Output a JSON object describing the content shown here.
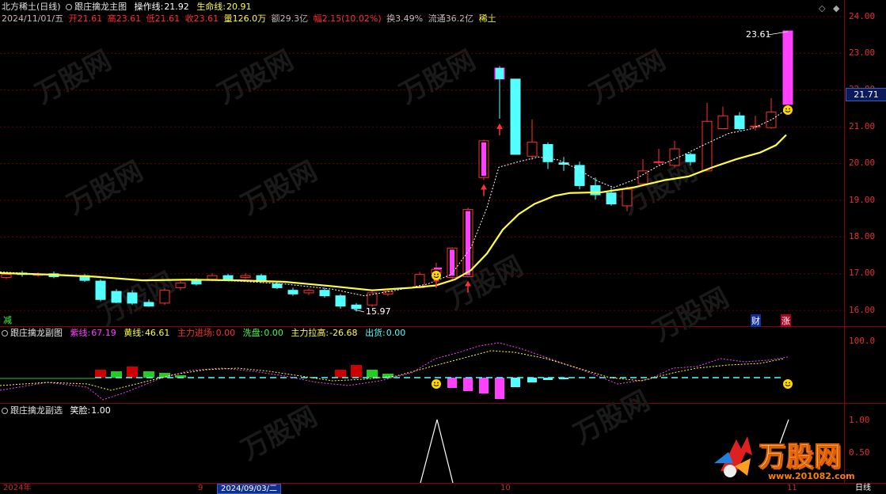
{
  "main_header": {
    "name": "北方稀土(日线)",
    "indicator": "跟庄擒龙主图",
    "caozuo_label": "操作线:",
    "caozuo_value": "21.92",
    "shengming_label": "生命线:",
    "shengming_value": "20.91",
    "date": "2024/11/01/五",
    "open_label": "开",
    "open": "21.61",
    "high_label": "高",
    "high": "23.61",
    "low_label": "低",
    "low": "21.61",
    "close_label": "收",
    "close": "23.61",
    "vol_label": "量",
    "vol": "126.0万",
    "amount_label": "额",
    "amount": "29.3亿",
    "range_label": "幅",
    "range": "2.15(10.02%)",
    "turnover_label": "换",
    "turnover": "3.49%",
    "float_label": "流通",
    "float": "36.2亿",
    "concept": "稀土"
  },
  "sub1_header": {
    "name": "跟庄擒龙副图",
    "purple_label": "紫线:",
    "purple": "67.19",
    "yellow_label": "黄线:",
    "yellow": "46.61",
    "zhuli_in_label": "主力进场:",
    "zhuli_in": "0.00",
    "xipan_label": "洗盘:",
    "xipan": "0.00",
    "lagao_label": "主力拉高:",
    "lagao": "-26.68",
    "chuhuo_label": "出货:",
    "chuhuo": "0.00"
  },
  "sub2_header": {
    "name": "跟庄擒龙副选",
    "smile_label": "笑脸:",
    "smile": "1.00"
  },
  "price_axis": [
    "24.00",
    "23.00",
    "22.00",
    "21.00",
    "20.00",
    "19.00",
    "18.00",
    "17.00",
    "16.00"
  ],
  "current_price_tag": "21.71",
  "sub1_axis": [
    "100.0"
  ],
  "sub2_axis": [
    "1.00",
    "0.50"
  ],
  "annotations": {
    "high_label": "23.61",
    "low_label": "15.97",
    "jian": "减",
    "cai": "财",
    "zhang": "涨"
  },
  "bottom_axis": {
    "year": "2024年",
    "tick_9": "9",
    "cursor_date": "2024/09/03/二",
    "tick_10": "10",
    "tick_11": "11",
    "period": "日线"
  },
  "watermark": {
    "brand": "万股网",
    "url": "www.201082.com"
  },
  "colors": {
    "up": "#ff3030",
    "down": "#54ffff",
    "ma_yellow": "#ffff40",
    "magenta": "#ff40ff",
    "axis_red": "#e03030"
  }
}
